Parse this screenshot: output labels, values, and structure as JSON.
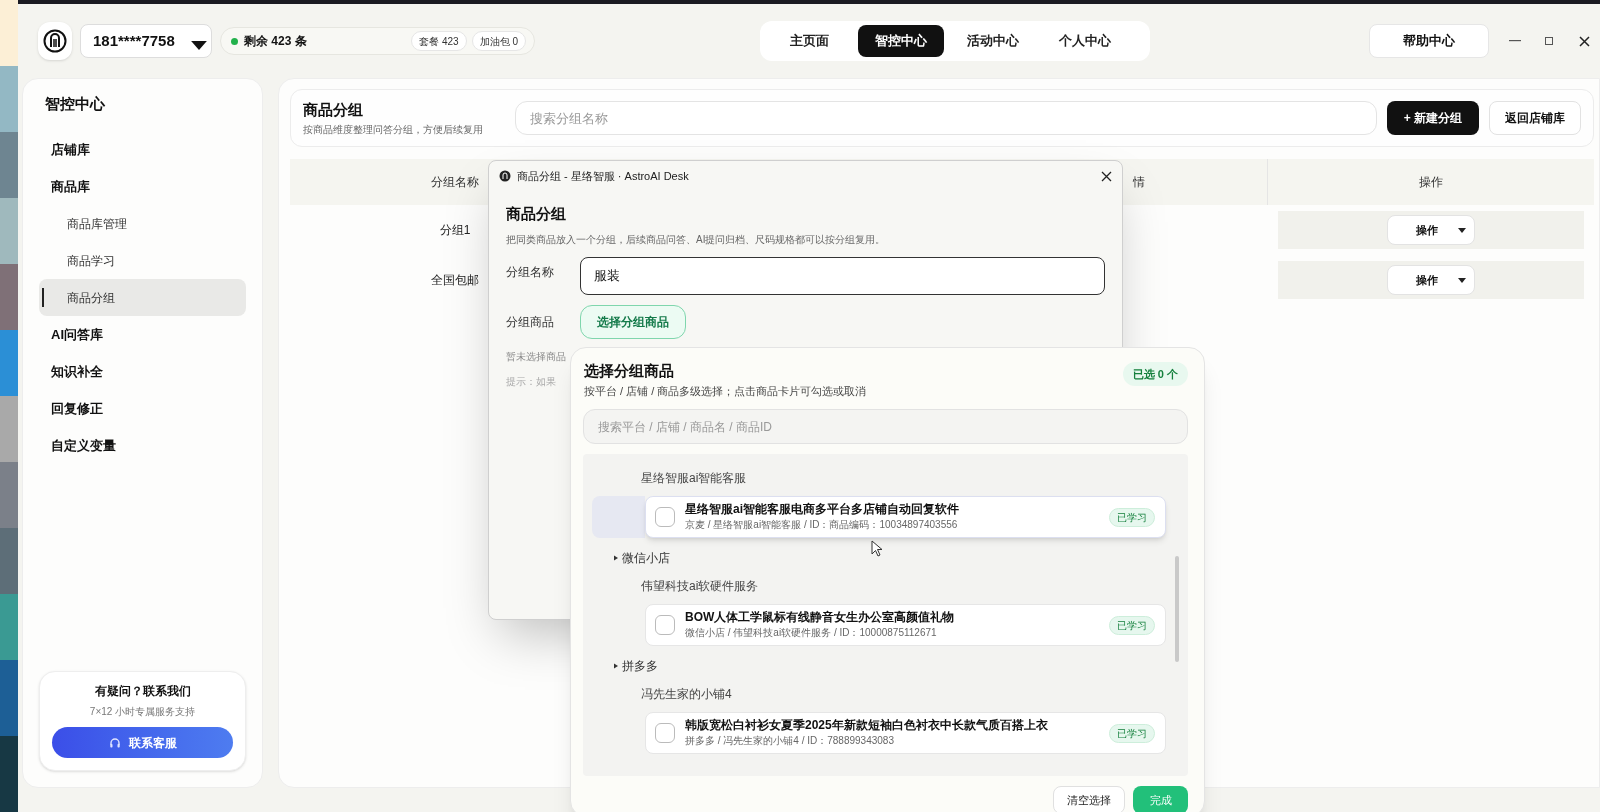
{
  "header": {
    "account": "181****7758",
    "remaining": "剩余 423 条",
    "plan_badges": [
      "套餐 423",
      "加油包 0"
    ],
    "nav_tabs": [
      {
        "label": "主页面",
        "selected": false
      },
      {
        "label": "智控中心",
        "selected": true
      },
      {
        "label": "活动中心",
        "selected": false
      },
      {
        "label": "个人中心",
        "selected": false
      }
    ],
    "help_button": "帮助中心"
  },
  "sidebar": {
    "title": "智控中心",
    "items": [
      {
        "label": "店铺库",
        "selected": false
      },
      {
        "label": "商品库",
        "selected": false,
        "children": [
          {
            "label": "商品库管理",
            "selected": false
          },
          {
            "label": "商品学习",
            "selected": false
          },
          {
            "label": "商品分组",
            "selected": true
          }
        ]
      },
      {
        "label": "AI问答库",
        "selected": false
      },
      {
        "label": "知识补全",
        "selected": false
      },
      {
        "label": "回复修正",
        "selected": false
      },
      {
        "label": "自定义变量",
        "selected": false
      }
    ],
    "help_card": {
      "title": "有疑问？联系我们",
      "subtitle": "7×12 小时专属服务支持",
      "button": "联系客服"
    }
  },
  "page": {
    "title": "商品分组",
    "subtitle": "按商品维度整理问答分组，方便后续复用",
    "search": {
      "placeholder": "搜索分组名称"
    },
    "buttons": [
      {
        "label": "+ 新建分组",
        "kind": "primary"
      },
      {
        "label": "返回店铺库",
        "kind": "secondary"
      }
    ],
    "table": {
      "columns": [
        "分组名称",
        "情",
        "操作"
      ],
      "rows": [
        {
          "name": "分组1",
          "action": "操作"
        },
        {
          "name": "全国包邮",
          "action": "操作"
        }
      ]
    }
  },
  "dialog": {
    "title": "商品分组 - 星络智服 · AstroAI Desk",
    "heading": "商品分组",
    "description": "把同类商品放入一个分组，后续商品问答、AI提问归档、尺码规格都可以按分组复用。",
    "name_label": "分组名称",
    "name_value": "服装",
    "products_label": "分组商品",
    "select_button": "选择分组商品",
    "empty_note": "暂未选择商品",
    "hint": "提示：如果"
  },
  "picker": {
    "title": "选择分组商品",
    "subtitle": "按平台 / 店铺 / 商品多级选择；点击商品卡片可勾选或取消",
    "selected_count": "已选 0 个",
    "search": {
      "placeholder": "搜索平台 / 店铺 / 商品名 / 商品ID"
    },
    "tree": [
      {
        "kind": "shop",
        "label": "星络智服ai智能客服",
        "children": [
          {
            "kind": "product",
            "title": "星络智服ai智能客服电商多平台多店铺自动回复软件",
            "meta": "京麦 / 星络智服ai智能客服 / ID：商品编码：10034897403556",
            "badge": "已学习",
            "checked": false,
            "highlighted": true
          }
        ]
      },
      {
        "kind": "platform",
        "label": "微信小店",
        "children": [
          {
            "kind": "shop",
            "label": "伟望科技ai软硬件服务",
            "children": [
              {
                "kind": "product",
                "title": "BOW人体工学鼠标有线静音女生办公室高颜值礼物",
                "meta": "微信小店 / 伟望科技ai软硬件服务 / ID：10000875112671",
                "badge": "已学习",
                "checked": false,
                "highlighted": false
              }
            ]
          }
        ]
      },
      {
        "kind": "platform",
        "label": "拼多多",
        "children": [
          {
            "kind": "shop",
            "label": "冯先生家的小铺4",
            "children": [
              {
                "kind": "product",
                "title": "韩版宽松白衬衫女夏季2025年新款短袖白色衬衣中长款气质百搭上衣",
                "meta": "拼多多 / 冯先生家的小铺4 / ID：788899343083",
                "badge": "已学习",
                "checked": false,
                "highlighted": false
              }
            ]
          }
        ]
      }
    ],
    "buttons": [
      {
        "label": "清空选择",
        "kind": "secondary"
      },
      {
        "label": "完成",
        "kind": "primary"
      }
    ]
  }
}
